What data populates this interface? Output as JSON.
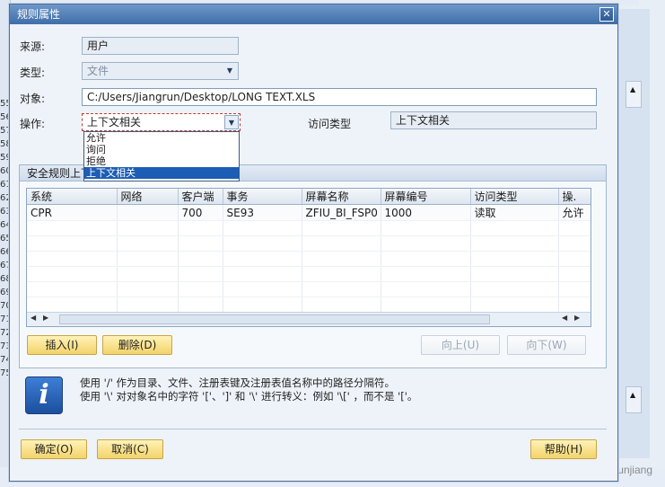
{
  "dialog": {
    "title": "规则属性",
    "close_glyph": "✕"
  },
  "form": {
    "source_label": "来源:",
    "source_value": "用户",
    "type_label": "类型:",
    "type_value": "文件",
    "object_label": "对象:",
    "object_value": "C:/Users/Jiangrun/Desktop/LONG TEXT.XLS",
    "operation_label": "操作:",
    "operation_value": "上下文相关",
    "access_type_label": "访问类型",
    "access_type_value": "上下文相关"
  },
  "operation_options": [
    "允许",
    "询问",
    "拒绝",
    "上下文相关"
  ],
  "operation_selected_index": 3,
  "security_group": {
    "title": "安全规则上下",
    "columns": [
      "系统",
      "网络",
      "客户端",
      "事务",
      "屏幕名称",
      "屏幕编号",
      "访问类型",
      "操."
    ],
    "rows": [
      [
        "CPR",
        "",
        "700",
        "SE93",
        "ZFIU_BI_FSP0",
        "1000",
        "读取",
        "允许"
      ]
    ],
    "insert_label": "插入(I)",
    "delete_label": "删除(D)",
    "up_label": "向上(U)",
    "down_label": "向下(W)"
  },
  "info": {
    "line1": "使用 '/' 作为目录、文件、注册表键及注册表值名称中的路径分隔符。",
    "line2": "使用 '\\' 对对象名中的字符 '['、']' 和 '\\' 进行转义：例如 '\\[' ，而不是 '['。"
  },
  "footer": {
    "ok_label": "确定(O)",
    "cancel_label": "取消(C)",
    "help_label": "帮助(H)"
  },
  "background": {
    "left_numbers": [
      "55",
      "56",
      "57",
      "58",
      "59",
      "60",
      "61",
      "62",
      "63",
      "64",
      "65",
      "66",
      "67",
      "68",
      "69",
      "70",
      "71",
      "72",
      "73",
      "74",
      "75"
    ],
    "watermark": "CSDN @IamRunjiang"
  },
  "colors": {
    "title_bar": "#3f6ea8",
    "selection": "#1c5db5",
    "button_yellow": "#f3d36a"
  }
}
